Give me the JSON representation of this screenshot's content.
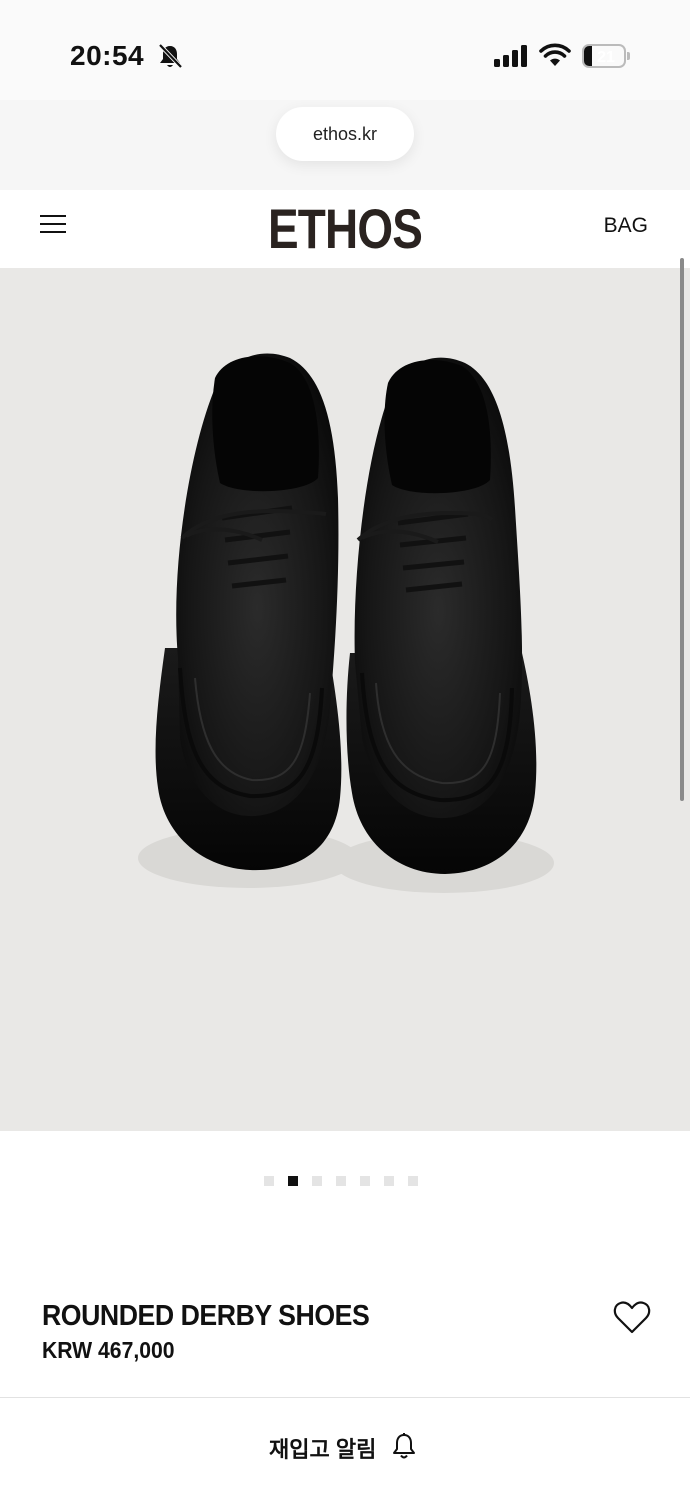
{
  "status_bar": {
    "time": "20:54",
    "battery_level": "21",
    "battery_fraction": 0.21,
    "icons": [
      "mute-bell-icon",
      "cellular-signal-icon",
      "wifi-icon",
      "battery-icon"
    ]
  },
  "browser": {
    "url": "ethos.kr"
  },
  "header": {
    "logo": "ETHOS",
    "bag_label": "BAG",
    "menu_icon": "hamburger-menu-icon"
  },
  "gallery": {
    "image_subject": "black-derby-shoes",
    "background_color": "#e9e8e6",
    "slide_count": 7,
    "active_slide": 2
  },
  "product": {
    "name": "ROUNDED DERBY SHOES",
    "price": "KRW 467,000",
    "wishlist_icon": "heart-outline-icon"
  },
  "actions": {
    "restock_label": "재입고 알림",
    "restock_icon": "bell-icon"
  }
}
